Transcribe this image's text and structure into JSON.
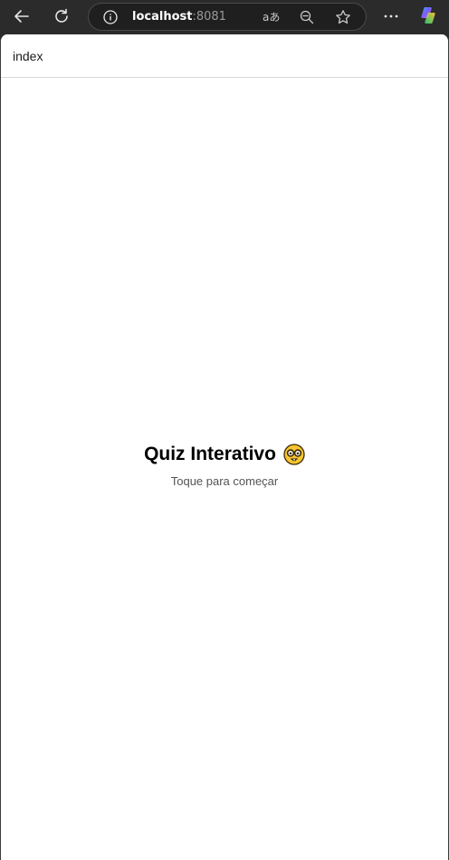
{
  "browser": {
    "url_host": "localhost",
    "url_port": ":8081",
    "translate_glyph": "aあ",
    "more_glyph": "···"
  },
  "app": {
    "header_title": "index",
    "quiz_title": "Quiz Interativo",
    "quiz_emoji": "nerd-face",
    "subtitle": "Toque para começar"
  }
}
